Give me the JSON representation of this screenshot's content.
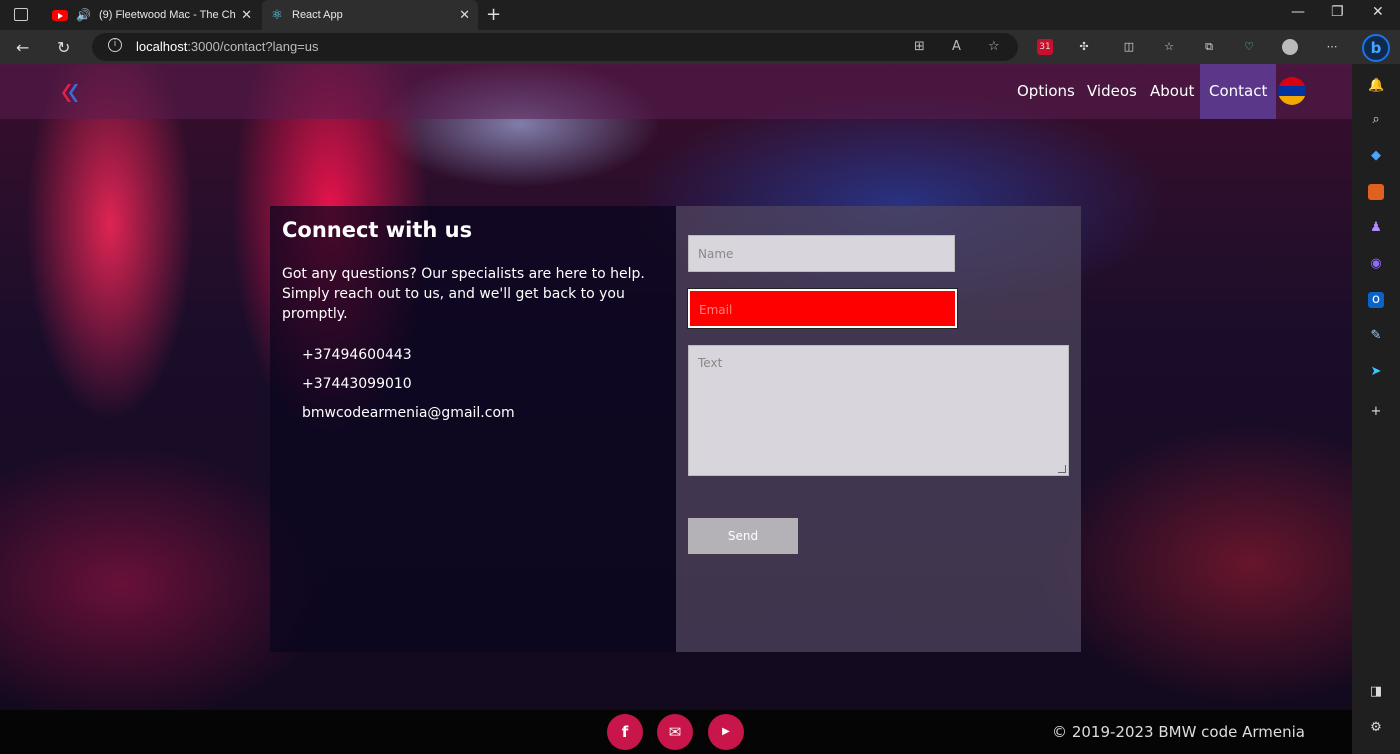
{
  "browser": {
    "tabs": [
      {
        "title": "(9) Fleetwood Mac - The Ch",
        "icon": "youtube-icon"
      },
      {
        "title": "React App",
        "icon": "react-icon"
      }
    ],
    "url_host": "localhost",
    "url_rest": ":3000/contact?lang=us",
    "extension_badge": "31"
  },
  "nav": {
    "links": [
      "Options",
      "Videos",
      "About",
      "Contact"
    ],
    "active": "Contact",
    "flag_colors": [
      "#d90012",
      "#0033a0",
      "#f2a800"
    ]
  },
  "contact": {
    "title": "Connect with us",
    "description": "Got any questions? Our specialists are here to help. Simply reach out to us, and we'll get back to you promptly.",
    "phone1": "+37494600443",
    "phone2": "+37443099010",
    "email": "bmwcodearmenia@gmail.com"
  },
  "form": {
    "name_placeholder": "Name",
    "email_placeholder": "Email",
    "text_placeholder": "Text",
    "send_label": "Send",
    "email_error_color": "#ff0000"
  },
  "footer": {
    "icons": [
      "facebook-icon",
      "mail-icon",
      "youtube-icon"
    ],
    "copyright": "© 2019-2023 BMW code Armenia"
  }
}
